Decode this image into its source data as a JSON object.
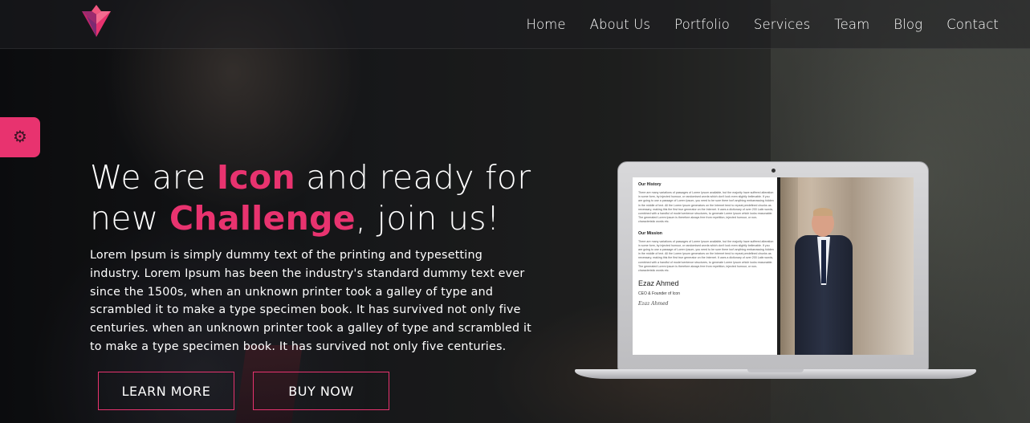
{
  "colors": {
    "accent": "#e8336f",
    "text": "#ffffff",
    "navbar_bg": "rgba(30,30,32,0.55)"
  },
  "brand": {
    "logo_icon": "heart-diamond-logo-icon"
  },
  "nav": {
    "items": [
      "Home",
      "About Us",
      "Portfolio",
      "Services",
      "Team",
      "Blog",
      "Contact"
    ]
  },
  "settings": {
    "icon": "gear-icon"
  },
  "hero": {
    "headline_part1": "We are ",
    "headline_accent1": "Icon",
    "headline_part2": " and ready for",
    "headline_part3": "new ",
    "headline_accent2": "Challenge",
    "headline_part4": ", join us!",
    "description": "Lorem Ipsum is simply dummy text of the printing and typesetting industry. Lorem Ipsum has been the industry's standard dummy text ever since the 1500s, when an unknown printer took a galley of type and scrambled it to make a type specimen book. It has survived not only five centuries. when an unknown printer took a galley of type and scrambled it to make a type specimen book. It has survived not only five centuries.",
    "learn_more_label": "LEARN MORE",
    "buy_now_label": "BUY NOW"
  },
  "laptop_screen": {
    "history_title": "Our History",
    "history_text": "There are many variations of passages of Lorem Ipsum available, but the majority have suffered alteration in some form, by injected humour, or randomised words which don't look even slightly believable. If you are going to use a passage of Lorem Ipsum, you need to be sure there isn't anything embarrassing hidden in the middle of text. All the Lorem Ipsum generators on the Internet tend to repeat predefined chunks as necessary, making this the first true generator on the Internet. It uses a dictionary of over 200 Latin words, combined with a handful of model sentence structures, to generate Lorem Ipsum which looks reasonable. The generated Lorem Ipsum is therefore always free from repetition, injected humour, or non-characteristic words etc.",
    "mission_title": "Our Mission",
    "mission_text": "There are many variations of passages of Lorem Ipsum available, but the majority have suffered alteration in some form, by injected humour, or randomised words which don't look even slightly believable. If you are going to use a passage of Lorem Ipsum, you need to be sure there isn't anything embarrassing hidden in the middle of text. All the Lorem Ipsum generators on the Internet tend to repeat predefined chunks as necessary, making this the first true generator on the Internet. It uses a dictionary of over 200 Latin words, combined with a handful of model sentence structures, to generate Lorem Ipsum which looks reasonable. The generated Lorem Ipsum is therefore always free from repetition, injected humour, or non-characteristic words etc.",
    "person_name": "Ezaz Ahmed",
    "person_role": "CEO & Founder of Icon",
    "signature": "Ezaz Ahmed"
  }
}
